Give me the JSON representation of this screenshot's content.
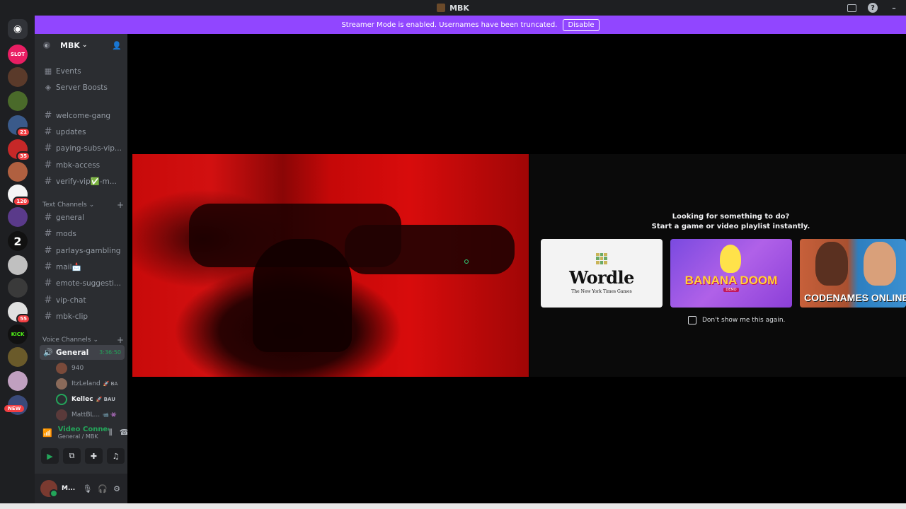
{
  "window": {
    "title": "MBK"
  },
  "banner": {
    "text": "Streamer Mode is enabled. Usernames have been truncated.",
    "button": "Disable"
  },
  "guilds": [
    {
      "name": "discord-home",
      "color": "#5865f2",
      "badge": ""
    },
    {
      "name": "slot",
      "label": "SLOT",
      "color": "#e91e63",
      "badge": ""
    },
    {
      "name": "server-2",
      "color": "#5a3a2a",
      "badge": ""
    },
    {
      "name": "server-3",
      "color": "#4a6a2a",
      "badge": ""
    },
    {
      "name": "server-4",
      "color": "#3a5a8a",
      "badge": "21"
    },
    {
      "name": "server-5",
      "color": "#c62828",
      "badge": "35"
    },
    {
      "name": "server-6",
      "color": "#b06040",
      "badge": ""
    },
    {
      "name": "server-7",
      "color": "#f5f5f5",
      "badge": "120"
    },
    {
      "name": "server-8",
      "color": "#5a3a8a",
      "badge": ""
    },
    {
      "name": "server-9",
      "color": "#111111",
      "label": "2",
      "badge": ""
    },
    {
      "name": "server-10",
      "color": "#c0c0c0",
      "badge": ""
    },
    {
      "name": "server-11",
      "color": "#3a3a3a",
      "badge": ""
    },
    {
      "name": "server-12",
      "color": "#e0e0e0",
      "badge": "55"
    },
    {
      "name": "server-kick",
      "color": "#111111",
      "label": "KICK",
      "badge": ""
    },
    {
      "name": "server-14",
      "color": "#6a5a2a",
      "badge": ""
    },
    {
      "name": "server-15",
      "color": "#c0a0c0",
      "badge": ""
    },
    {
      "name": "server-16",
      "color": "#3a4a7a",
      "badge": ""
    }
  ],
  "new_badge": "NEW",
  "server": {
    "name": "MBK"
  },
  "top_items": [
    {
      "label": "Events",
      "icon": "calendar-icon"
    },
    {
      "label": "Server Boosts",
      "icon": "boost-icon"
    }
  ],
  "channels_top": [
    {
      "label": "welcome-gang"
    },
    {
      "label": "updates"
    },
    {
      "label": "paying-subs-vip..."
    },
    {
      "label": "mbk-access"
    },
    {
      "label": "verify-vip✅-m..."
    }
  ],
  "text_category": "Text Channels",
  "text_channels": [
    {
      "label": "general"
    },
    {
      "label": "mods"
    },
    {
      "label": "parlays-gambling"
    },
    {
      "label": "mail📩"
    },
    {
      "label": "emote-suggesti..."
    },
    {
      "label": "vip-chat"
    },
    {
      "label": "mbk-clip"
    }
  ],
  "voice_category": "Voice Channels",
  "voice_channel": {
    "label": "General",
    "timer": "3:36:50"
  },
  "voice_users": [
    {
      "name": "940",
      "tag": "",
      "color": "#7a4a3a"
    },
    {
      "name": "ItzLeland",
      "tag": "🚀 BA",
      "color": "#8a6a5a"
    },
    {
      "name": "Kellec",
      "tag": "🚀 BAU",
      "color": "#2b2d31"
    },
    {
      "name": "MattBL...",
      "tag": "📹 👾",
      "color": "#5a3a3a"
    }
  ],
  "voice_connection": {
    "title": "Video Connected",
    "subtitle": "General / MBK"
  },
  "user": {
    "name": "M..."
  },
  "activity": {
    "prompt_line1": "Looking for something to do?",
    "prompt_line2": "Start a game or video playlist instantly.",
    "wordle": {
      "name": "Wordle",
      "sub": "The New York Times Games"
    },
    "banana": {
      "name": "BANANA DOOM",
      "demo": "DEMO"
    },
    "codenames": {
      "name": "CODENAMES ONLINE"
    },
    "dont_show": "Don't show me this again."
  }
}
